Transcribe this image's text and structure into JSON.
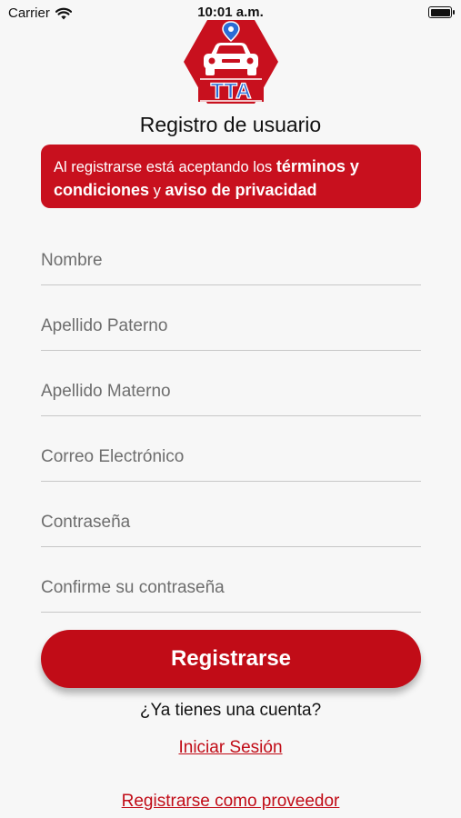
{
  "status_bar": {
    "carrier": "Carrier",
    "time": "10:01 a.m."
  },
  "logo": {
    "text": "TTA"
  },
  "page_title": "Registro de usuario",
  "terms": {
    "prefix": "Al registrarse está aceptando los ",
    "terms_link": "términos y condiciones",
    "connector": " y ",
    "privacy_link": "aviso de privacidad"
  },
  "form": {
    "fields": [
      {
        "placeholder": "Nombre",
        "value": ""
      },
      {
        "placeholder": "Apellido Paterno",
        "value": ""
      },
      {
        "placeholder": "Apellido Materno",
        "value": ""
      },
      {
        "placeholder": "Correo Electrónico",
        "value": ""
      },
      {
        "placeholder": "Contraseña",
        "value": ""
      },
      {
        "placeholder": "Confirme su contraseña",
        "value": ""
      }
    ]
  },
  "register_button_label": "Registrarse",
  "have_account_text": "¿Ya tienes una cuenta?",
  "login_link": "Iniciar Sesión",
  "provider_link": "Registrarse como proveedor",
  "colors": {
    "brand_red": "#c10c17",
    "logo_blue": "#2b6cd6",
    "background": "#f7f7f7"
  },
  "icons": [
    "wifi-icon",
    "battery-icon",
    "car-icon",
    "location-pin-icon"
  ]
}
